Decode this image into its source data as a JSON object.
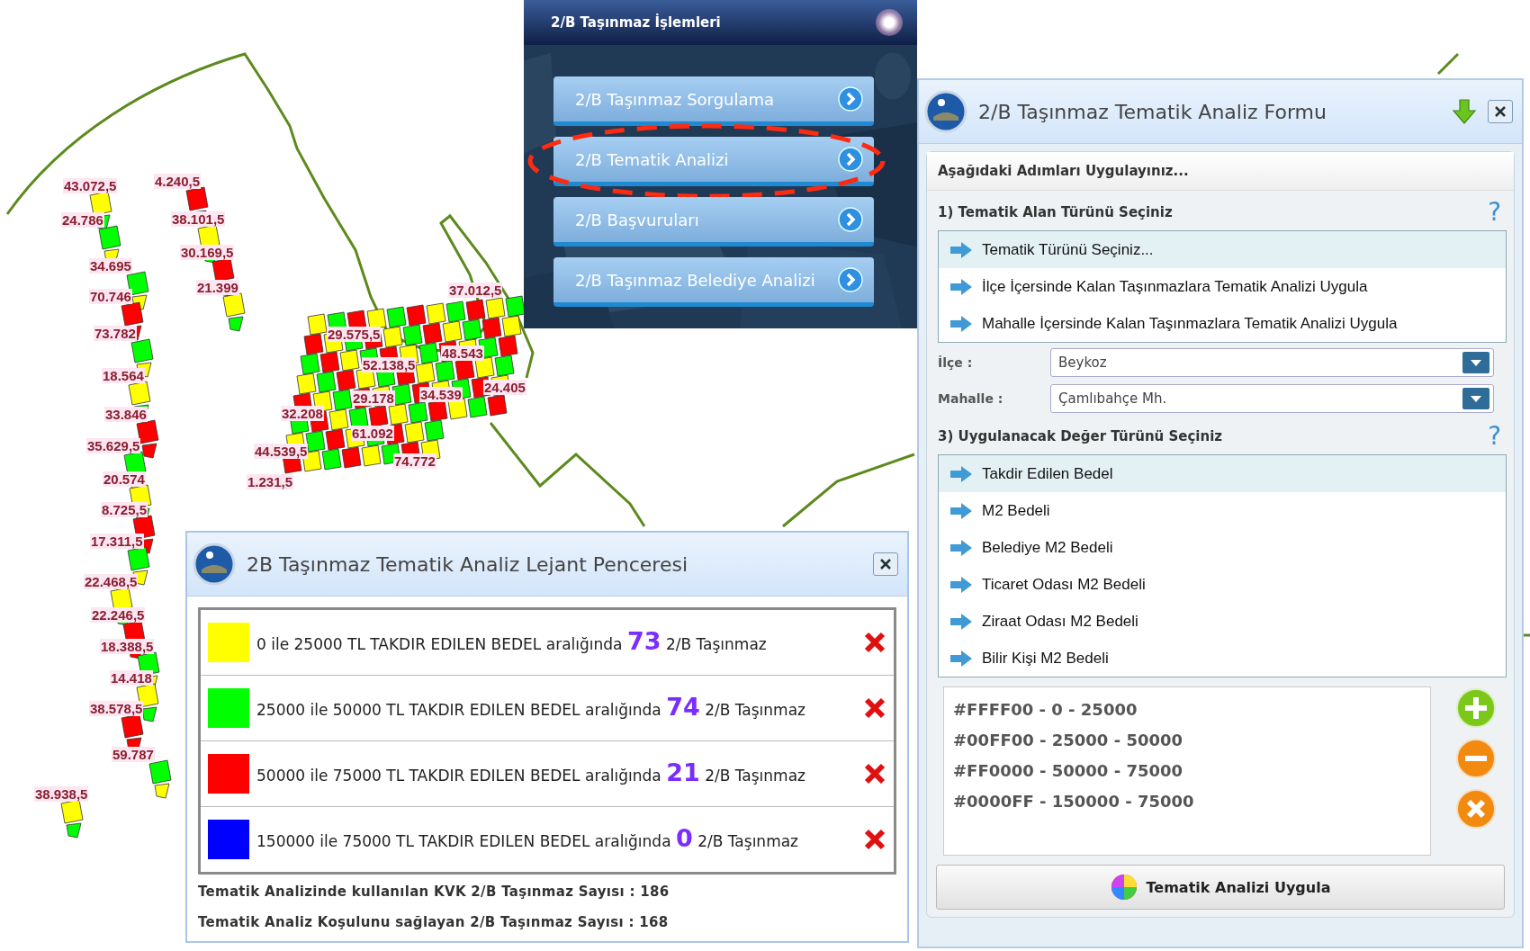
{
  "map": {
    "parcel_labels": [
      "43.072,5",
      "4.240,5",
      "24.786",
      "38.101,5",
      "30.169,5",
      "34.695",
      "21.399",
      "70.746",
      "73.782",
      "18.564",
      "33.846",
      "35.629,5",
      "20.574",
      "8.725,5",
      "17.311,5",
      "22.468,5",
      "22.246,5",
      "18.388,5",
      "14.418",
      "38.578,5",
      "59.787",
      "38.938,5",
      "37.012,5",
      "29.575,5",
      "52.138,5",
      "48.543",
      "29.178",
      "34.539",
      "24.405",
      "32.208",
      "61.092",
      "44.539,5",
      "74.772",
      "1.231,5"
    ]
  },
  "menu_panel": {
    "title": "2/B Taşınmaz İşlemleri",
    "buttons": [
      {
        "label": "2/B Taşınmaz Sorgulama",
        "circled": false
      },
      {
        "label": "2/B Tematik Analizi",
        "circled": true
      },
      {
        "label": "2/B Başvuruları",
        "circled": false
      },
      {
        "label": "2/B Taşınmaz Belediye Analizi",
        "circled": false
      }
    ]
  },
  "legend_window": {
    "title": "2B Taşınmaz Tematik Analiz Lejant Penceresi",
    "entries": [
      {
        "color": "#ffff00",
        "range_text": "0 ile 25000 TL TAKDIR EDILEN BEDEL aralığında",
        "count": "73",
        "unit": "2/B Taşınmaz"
      },
      {
        "color": "#00ff00",
        "range_text": "25000 ile 50000 TL TAKDIR EDILEN BEDEL aralığında",
        "count": "74",
        "unit": "2/B Taşınmaz"
      },
      {
        "color": "#ff0000",
        "range_text": "50000 ile 75000 TL TAKDIR EDILEN BEDEL aralığında",
        "count": "21",
        "unit": "2/B Taşınmaz"
      },
      {
        "color": "#0000ff",
        "range_text": "150000 ile 75000 TL TAKDIR EDILEN BEDEL aralığında",
        "count": "0",
        "unit": "2/B Taşınmaz"
      }
    ],
    "summary": [
      "Tematik Analizinde kullanılan KVK 2/B Taşınmaz Sayısı : 186",
      "Tematik Analiz Koşulunu sağlayan 2/B Taşınmaz Sayısı : 168"
    ]
  },
  "form_window": {
    "title": "2/B Taşınmaz Tematik Analiz Formu",
    "instruction": "Aşağıdaki Adımları Uygulayınız...",
    "step1": {
      "heading": "1) Tematik Alan Türünü Seçiniz",
      "help": "?",
      "options": [
        {
          "label": "Tematik Türünü Seçiniz...",
          "selected": true
        },
        {
          "label": "İlçe İçersinde Kalan Taşınmazlara Tematik Analizi Uygula",
          "selected": false
        },
        {
          "label": "Mahalle İçersinde Kalan Taşınmazlara Tematik Analizi Uygula",
          "selected": false
        }
      ]
    },
    "fields": [
      {
        "label": "İlçe :",
        "value": "Beykoz"
      },
      {
        "label": "Mahalle :",
        "value": "Çamlıbahçe Mh."
      }
    ],
    "step3": {
      "heading": "3) Uygulanacak Değer Türünü Seçiniz",
      "help": "?",
      "options": [
        {
          "label": "Takdir Edilen Bedel",
          "selected": true
        },
        {
          "label": "M2 Bedeli",
          "selected": false
        },
        {
          "label": "Belediye M2 Bedeli",
          "selected": false
        },
        {
          "label": "Ticaret Odası M2 Bedeli",
          "selected": false
        },
        {
          "label": "Ziraat Odası M2 Bedeli",
          "selected": false
        },
        {
          "label": "Bilir Kişi M2 Bedeli",
          "selected": false
        }
      ]
    },
    "color_ranges": [
      "#FFFF00 - 0 - 25000",
      "#00FF00 - 25000 - 50000",
      "#FF0000 - 50000 - 75000",
      "#0000FF - 150000 - 75000"
    ],
    "apply_button": "Tematik Analizi Uygula"
  }
}
